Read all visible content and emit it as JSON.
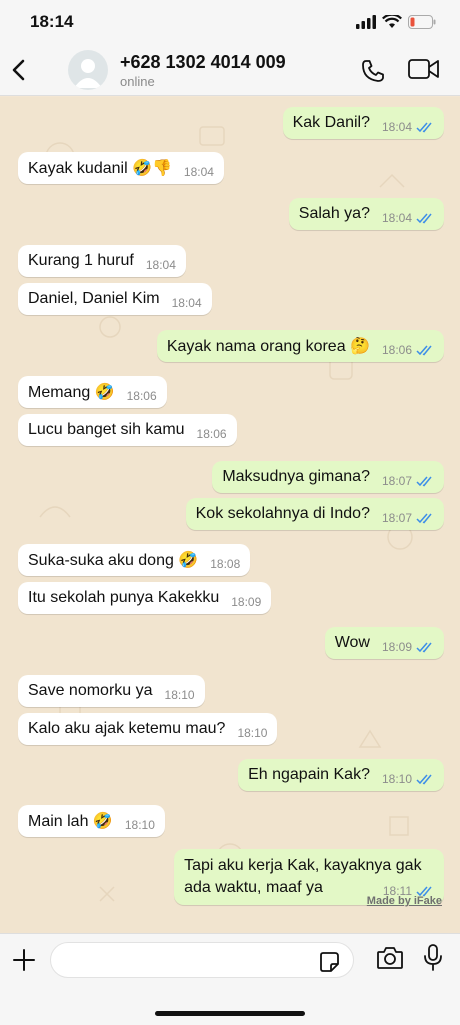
{
  "status_bar": {
    "time": "18:14"
  },
  "header": {
    "contact_name": "+628 1302 4014 009",
    "contact_status": "online"
  },
  "messages": [
    {
      "direction": "out",
      "text": "Kak Danil?",
      "time": "18:04"
    },
    {
      "direction": "in",
      "text": "Kayak kudanil 🤣👎",
      "time": "18:04"
    },
    {
      "direction": "out",
      "text": "Salah ya?",
      "time": "18:04"
    },
    {
      "direction": "in",
      "text": "Kurang 1 huruf",
      "time": "18:04"
    },
    {
      "direction": "in",
      "text": "Daniel, Daniel Kim",
      "time": "18:04"
    },
    {
      "direction": "out",
      "text": "Kayak nama orang korea 🤔",
      "time": "18:06"
    },
    {
      "direction": "in",
      "text": "Memang 🤣",
      "time": "18:06"
    },
    {
      "direction": "in",
      "text": "Lucu banget sih kamu",
      "time": "18:06"
    },
    {
      "direction": "out",
      "text": "Maksudnya gimana?",
      "time": "18:07"
    },
    {
      "direction": "out",
      "text": "Kok sekolahnya di Indo?",
      "time": "18:07"
    },
    {
      "direction": "in",
      "text": "Suka-suka aku dong 🤣",
      "time": "18:08"
    },
    {
      "direction": "in",
      "text": "Itu sekolah punya Kakekku",
      "time": "18:09"
    },
    {
      "direction": "out",
      "text": "Wow",
      "time": "18:09"
    },
    {
      "direction": "in",
      "text": "Save nomorku ya",
      "time": "18:10"
    },
    {
      "direction": "in",
      "text": "Kalo aku ajak ketemu mau?",
      "time": "18:10"
    },
    {
      "direction": "out",
      "text": "Eh ngapain Kak?",
      "time": "18:10"
    },
    {
      "direction": "in",
      "text": "Main lah 🤣",
      "time": "18:10"
    },
    {
      "direction": "out",
      "text_line1": "Tapi aku kerja Kak, kayaknya gak",
      "text_line2": "ada waktu, maaf ya",
      "time": "18:11"
    }
  ],
  "watermark": "Made by iFake",
  "colors": {
    "incoming_bubble": "#ffffff",
    "outgoing_bubble": "#e3f8c6",
    "read_ticks": "#3d8ee8",
    "chat_background": "#f1e4cf",
    "battery_low": "#e9523b"
  }
}
